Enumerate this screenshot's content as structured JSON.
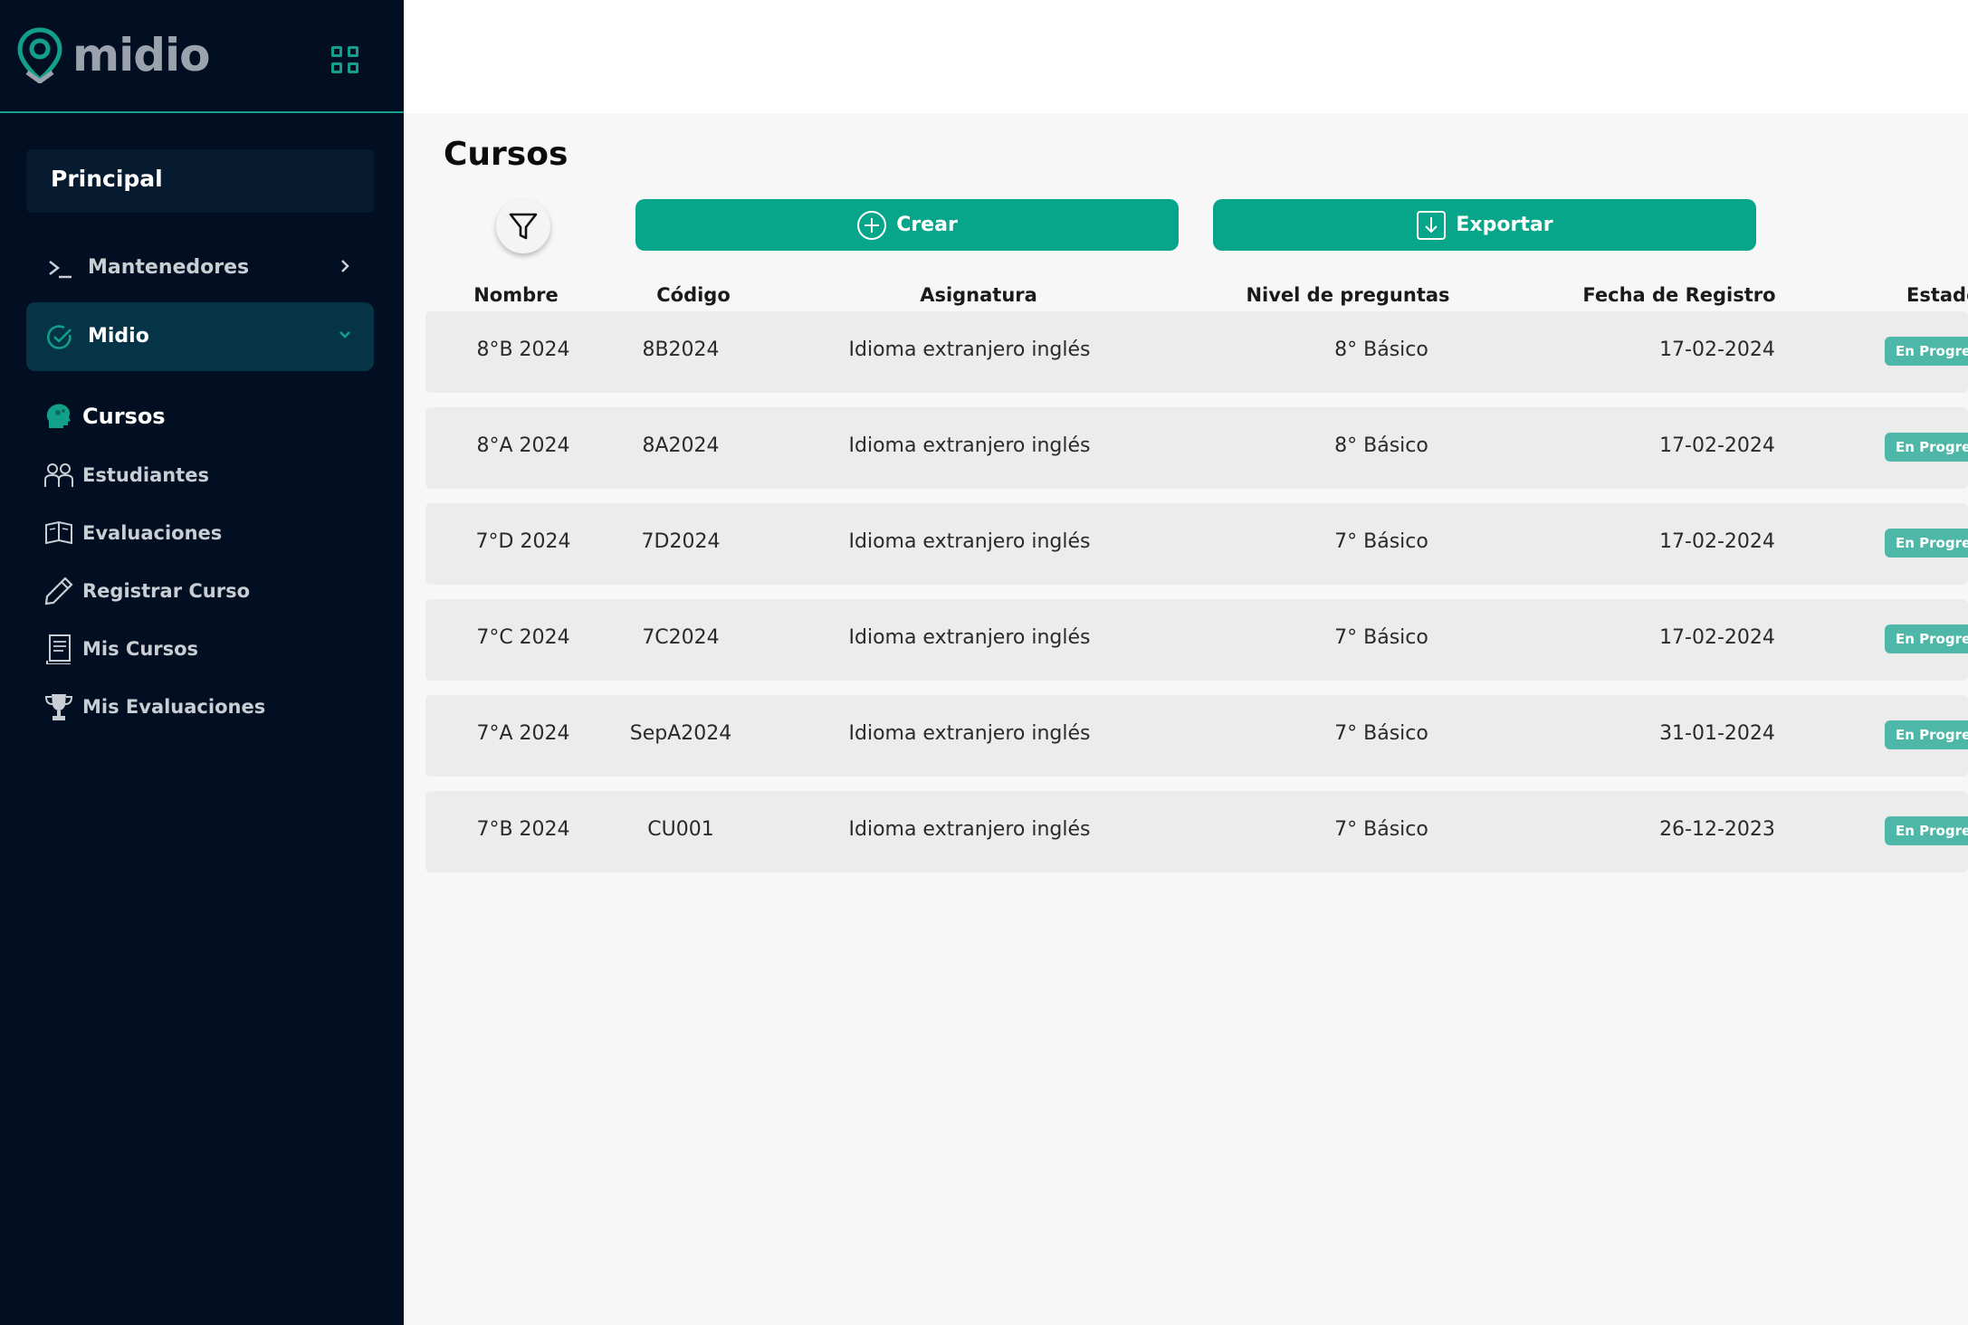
{
  "brand": {
    "name": "midio",
    "accent": "#12a08a",
    "sidebar_bg": "#020f22"
  },
  "sidebar": {
    "section_label": "Principal",
    "menus": [
      {
        "label": "Mantenedores",
        "icon": "terminal-icon",
        "expanded": false
      },
      {
        "label": "Midio",
        "icon": "check-circle-icon",
        "expanded": true
      }
    ],
    "sub_items": [
      {
        "label": "Cursos",
        "icon": "brain-head-icon",
        "active": true
      },
      {
        "label": "Estudiantes",
        "icon": "students-icon",
        "active": false
      },
      {
        "label": "Evaluaciones",
        "icon": "open-book-icon",
        "active": false
      },
      {
        "label": "Registrar Curso",
        "icon": "pencil-icon",
        "active": false
      },
      {
        "label": "Mis Cursos",
        "icon": "notebook-icon",
        "active": false
      },
      {
        "label": "Mis Evaluaciones",
        "icon": "trophy-icon",
        "active": false
      }
    ]
  },
  "main": {
    "title": "Cursos",
    "buttons": {
      "crear": "Crear",
      "exportar": "Exportar"
    },
    "columns": {
      "nombre": "Nombre",
      "codigo": "Código",
      "asignatura": "Asignatura",
      "nivel": "Nivel de preguntas",
      "fecha": "Fecha de Registro",
      "estado": "Estado"
    },
    "rows": [
      {
        "nombre": "8°B 2024",
        "codigo": "8B2024",
        "asignatura": "Idioma extranjero inglés",
        "nivel": "8° Básico",
        "fecha": "17-02-2024",
        "estado": "En Progreso"
      },
      {
        "nombre": "8°A 2024",
        "codigo": "8A2024",
        "asignatura": "Idioma extranjero inglés",
        "nivel": "8° Básico",
        "fecha": "17-02-2024",
        "estado": "En Progreso"
      },
      {
        "nombre": "7°D 2024",
        "codigo": "7D2024",
        "asignatura": "Idioma extranjero inglés",
        "nivel": "7° Básico",
        "fecha": "17-02-2024",
        "estado": "En Progreso"
      },
      {
        "nombre": "7°C 2024",
        "codigo": "7C2024",
        "asignatura": "Idioma extranjero inglés",
        "nivel": "7° Básico",
        "fecha": "17-02-2024",
        "estado": "En Progreso"
      },
      {
        "nombre": "7°A 2024",
        "codigo": "SepA2024",
        "asignatura": "Idioma extranjero inglés",
        "nivel": "7° Básico",
        "fecha": "31-01-2024",
        "estado": "En Progreso"
      },
      {
        "nombre": "7°B 2024",
        "codigo": "CU001",
        "asignatura": "Idioma extranjero inglés",
        "nivel": "7° Básico",
        "fecha": "26-12-2023",
        "estado": "En Progreso"
      }
    ]
  }
}
